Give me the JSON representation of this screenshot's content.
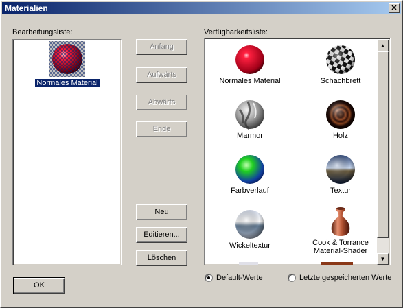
{
  "window": {
    "title": "Materialien",
    "close": "✕"
  },
  "edit_list": {
    "label": "Bearbeitungsliste:",
    "items": [
      {
        "label": "Normales Material",
        "selected": true
      }
    ]
  },
  "buttons": {
    "start": "Anfang",
    "up": "Aufwärts",
    "down": "Abwärts",
    "end": "Ende",
    "new": "Neu",
    "edit": "Editieren...",
    "delete": "Löschen",
    "ok": "OK"
  },
  "available_list": {
    "label": "Verfügbarkeitsliste:",
    "items": [
      {
        "label": "Normales Material",
        "icon": "red-sphere-icon"
      },
      {
        "label": "Schachbrett",
        "icon": "checker-sphere-icon"
      },
      {
        "label": "Marmor",
        "icon": "marble-sphere-icon"
      },
      {
        "label": "Holz",
        "icon": "wood-sphere-icon"
      },
      {
        "label": "Farbverlauf",
        "icon": "gradient-sphere-icon"
      },
      {
        "label": "Textur",
        "icon": "texture-sphere-icon"
      },
      {
        "label": "Wickeltextur",
        "icon": "wrap-texture-sphere-icon"
      },
      {
        "label": "Cook & Torrance Material-Shader",
        "icon": "vase-icon"
      }
    ]
  },
  "options": {
    "default_values": "Default-Werte",
    "last_saved": "Letzte gespeicherten Werte",
    "selected": "default_values"
  }
}
